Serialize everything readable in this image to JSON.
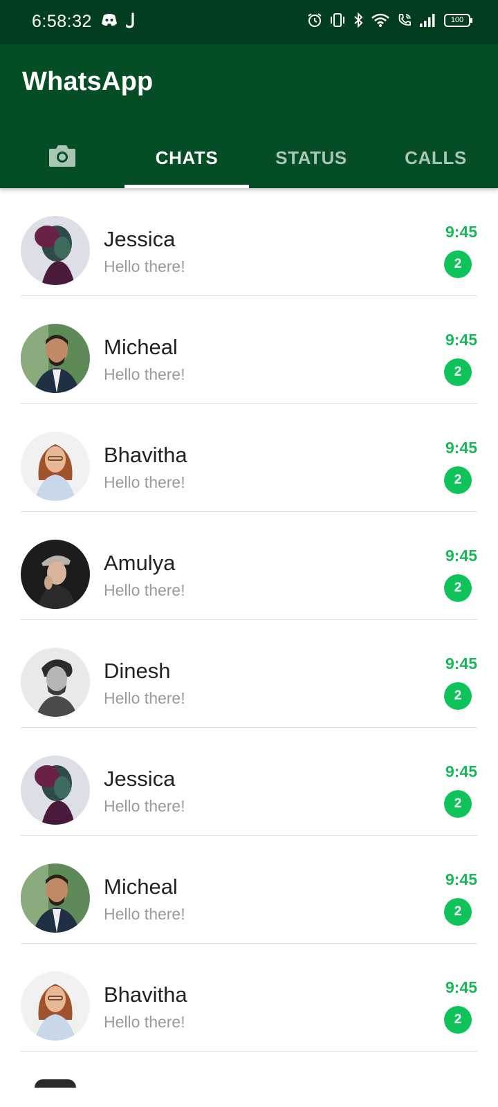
{
  "status_bar": {
    "time": "6:58:32",
    "left_icons": [
      "discord-icon",
      "j-app-icon"
    ],
    "right_icons": [
      "alarm-icon",
      "vibrate-icon",
      "bluetooth-icon",
      "wifi-icon",
      "wifi-calling-icon",
      "signal-icon"
    ],
    "battery": "100"
  },
  "app_bar": {
    "title": "WhatsApp",
    "background": "#054d25",
    "status_background": "#033d1f"
  },
  "tabs": [
    {
      "label": "",
      "icon": "camera-icon",
      "active": false
    },
    {
      "label": "CHATS",
      "active": true
    },
    {
      "label": "STATUS",
      "active": false
    },
    {
      "label": "CALLS",
      "active": false
    }
  ],
  "accent": "#16b857",
  "chats": [
    {
      "name": "Jessica",
      "message": "Hello there!",
      "time": "9:45",
      "unread": "2",
      "avatar": "woman-purple-portrait"
    },
    {
      "name": "Micheal",
      "message": "Hello there!",
      "time": "9:45",
      "unread": "2",
      "avatar": "man-smiling-suit"
    },
    {
      "name": "Bhavitha",
      "message": "Hello there!",
      "time": "9:45",
      "unread": "2",
      "avatar": "woman-glasses-redhair"
    },
    {
      "name": "Amulya",
      "message": "Hello there!",
      "time": "9:45",
      "unread": "2",
      "avatar": "woman-cap-dark"
    },
    {
      "name": "Dinesh",
      "message": "Hello there!",
      "time": "9:45",
      "unread": "2",
      "avatar": "man-bw-portrait"
    },
    {
      "name": "Jessica",
      "message": "Hello there!",
      "time": "9:45",
      "unread": "2",
      "avatar": "woman-purple-portrait"
    },
    {
      "name": "Micheal",
      "message": "Hello there!",
      "time": "9:45",
      "unread": "2",
      "avatar": "man-smiling-suit"
    },
    {
      "name": "Bhavitha",
      "message": "Hello there!",
      "time": "9:45",
      "unread": "2",
      "avatar": "woman-glasses-redhair"
    }
  ]
}
